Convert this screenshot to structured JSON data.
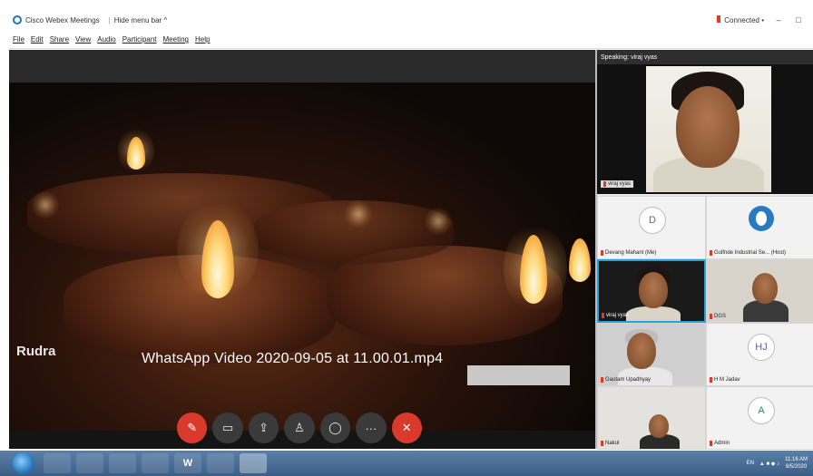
{
  "titlebar": {
    "app_title": "Cisco Webex Meetings",
    "hide_menu_bar": "Hide menu bar ^",
    "connection_status": "Connected •",
    "minimize": "–",
    "restore": "□"
  },
  "menubar": {
    "items": [
      "File",
      "Edit",
      "Share",
      "View",
      "Audio",
      "Participant",
      "Meeting",
      "Help"
    ]
  },
  "stage": {
    "video_caption": "WhatsApp Video 2020-09-05 at 11.00.01.mp4",
    "watermark": "Rudra"
  },
  "controls": {
    "icons": [
      "mute-icon",
      "video-icon",
      "share-icon",
      "participants-icon",
      "chat-icon",
      "more-icon",
      "leave-icon"
    ],
    "glyphs": {
      "mute": "✎",
      "video": "▭",
      "share": "⇪",
      "participants": "♙",
      "chat": "◯",
      "more": "···",
      "leave": "✕"
    }
  },
  "panel": {
    "speaking_label": "Speaking: viraj vyas",
    "active_speaker_name": "viraj vyas",
    "participants": [
      {
        "name": "Devang Mahant (Me)",
        "initials": "D",
        "type": "initials"
      },
      {
        "name": "Gulfnde Industrial Se... (Host)",
        "initials": "",
        "type": "logo"
      },
      {
        "name": "viraj vyas",
        "initials": "",
        "type": "video"
      },
      {
        "name": "DGS",
        "initials": "",
        "type": "video"
      },
      {
        "name": "Gautam Upadhyay",
        "initials": "",
        "type": "video"
      },
      {
        "name": "H M Jadav",
        "initials": "HJ",
        "type": "initials"
      },
      {
        "name": "Nakul",
        "initials": "",
        "type": "video"
      },
      {
        "name": "Admin",
        "initials": "A",
        "type": "initials"
      }
    ]
  },
  "taskbar": {
    "apps": [
      "",
      "",
      "",
      "",
      "",
      "W",
      "",
      ""
    ],
    "tray_lang": "EN",
    "clock_time": "11:16 AM",
    "clock_date": "9/5/2020"
  },
  "colors": {
    "leave_red": "#d93a2b",
    "speaker_highlight": "#2aa0d8",
    "taskbar": "#3b5e86"
  }
}
